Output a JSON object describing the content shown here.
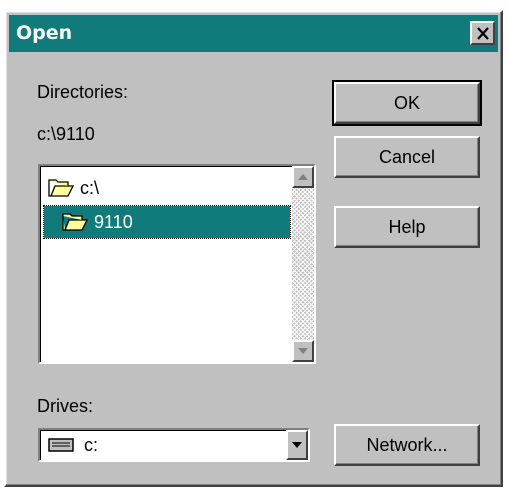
{
  "window": {
    "title": "Open"
  },
  "directories": {
    "label": "Directories:",
    "current_path": "c:\\9110",
    "items": [
      {
        "label": "c:\\",
        "icon": "open-folder-icon"
      },
      {
        "label": "9110",
        "icon": "open-folder-icon",
        "selected": true
      }
    ]
  },
  "drives": {
    "label": "Drives:",
    "selected": "c:",
    "icon": "hard-drive-icon"
  },
  "buttons": {
    "ok": "OK",
    "cancel": "Cancel",
    "help": "Help",
    "network": "Network..."
  },
  "colors": {
    "titlebar": "#117a7a",
    "selection": "#117a7a",
    "face": "#c0c0c0"
  }
}
